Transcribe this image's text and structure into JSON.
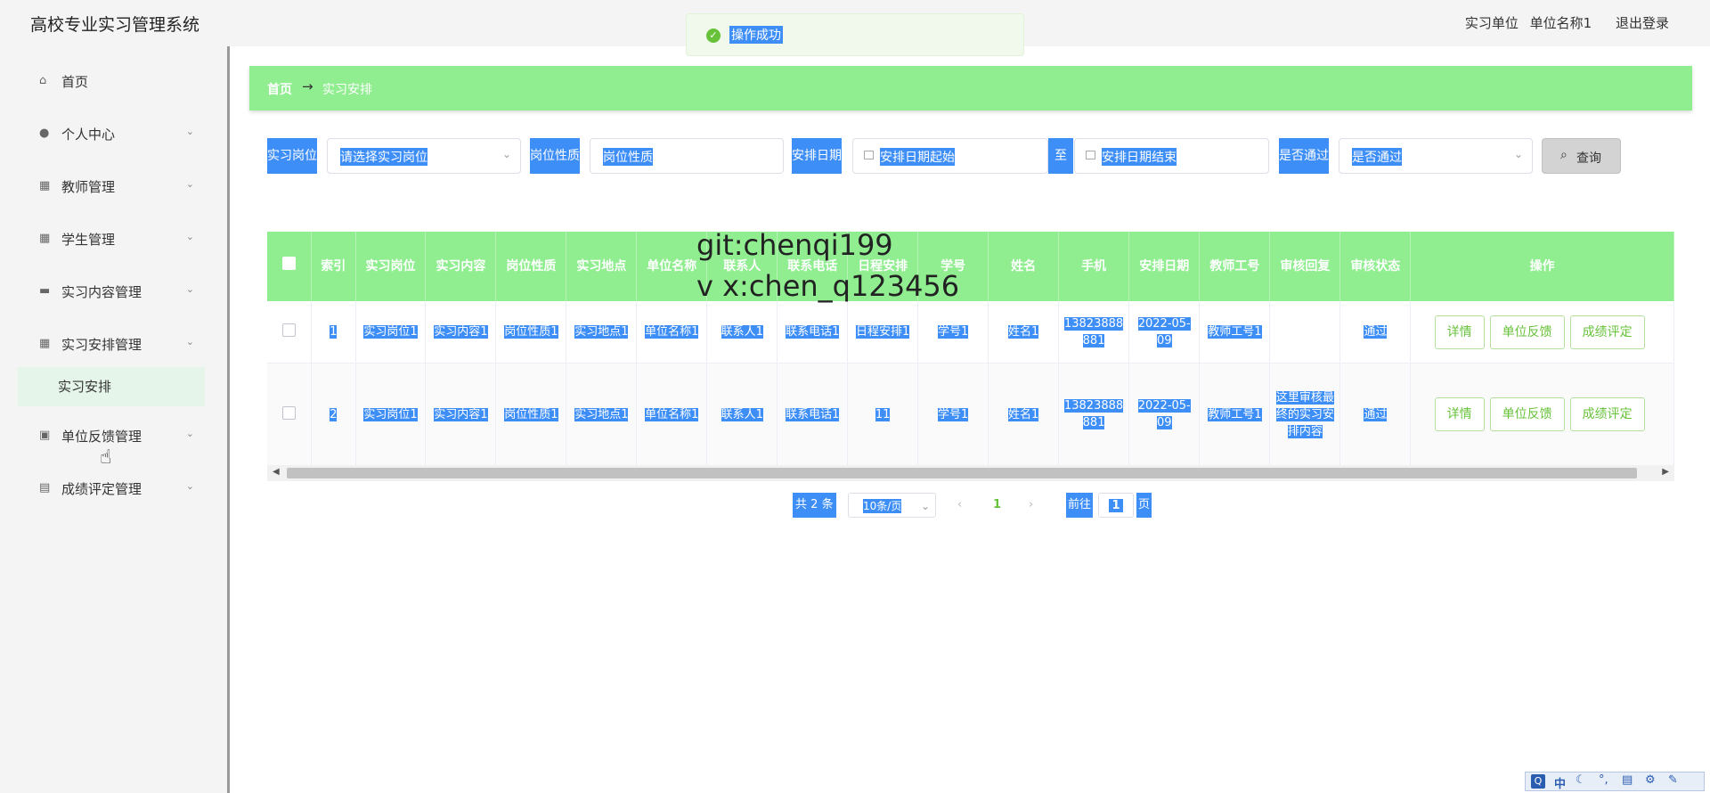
{
  "header": {
    "app_title": "高校专业实习管理系统",
    "role": "实习单位",
    "user_name": "单位名称1",
    "logout": "退出登录"
  },
  "toast": {
    "message": "操作成功"
  },
  "sidebar": {
    "items": [
      {
        "label": "首页",
        "icon": "home-icon"
      },
      {
        "label": "个人中心",
        "icon": "user-icon"
      },
      {
        "label": "教师管理",
        "icon": "grid-icon"
      },
      {
        "label": "学生管理",
        "icon": "grid-icon"
      },
      {
        "label": "实习内容管理",
        "icon": "ticket-icon"
      },
      {
        "label": "实习安排管理",
        "icon": "grid-icon"
      },
      {
        "label": "单位反馈管理",
        "icon": "briefcase-icon"
      },
      {
        "label": "成绩评定管理",
        "icon": "printer-icon"
      }
    ],
    "active_sub": "实习安排"
  },
  "breadcrumb": {
    "home": "首页",
    "separator": "→",
    "current": "实习安排"
  },
  "filters": {
    "position_label": "实习岗位",
    "position_placeholder": "请选择实习岗位",
    "nature_label": "岗位性质",
    "nature_placeholder": "岗位性质",
    "date_label": "安排日期",
    "date_start": "安排日期起始",
    "date_to": "至",
    "date_end": "安排日期结束",
    "pass_label": "是否通过",
    "pass_placeholder": "是否通过",
    "query": "查询"
  },
  "table": {
    "headers": [
      "索引",
      "实习岗位",
      "实习内容",
      "岗位性质",
      "实习地点",
      "单位名称",
      "联系人",
      "联系电话",
      "日程安排",
      "学号",
      "姓名",
      "手机",
      "安排日期",
      "教师工号",
      "审核回复",
      "审核状态",
      "操作"
    ],
    "rows": [
      [
        "1",
        "实习岗位1",
        "实习内容1",
        "岗位性质1",
        "实习地点1",
        "单位名称1",
        "联系人1",
        "联系电话1",
        "日程安排1",
        "学号1",
        "姓名1",
        "13823888881",
        "2022-05-09",
        "教师工号1",
        "",
        "通过"
      ],
      [
        "2",
        "实习岗位1",
        "实习内容1",
        "岗位性质1",
        "实习地点1",
        "单位名称1",
        "联系人1",
        "联系电话1",
        "11",
        "学号1",
        "姓名1",
        "13823888881",
        "2022-05-09",
        "教师工号1",
        "这里审核最终的实习安排内容",
        "通过"
      ]
    ],
    "actions": [
      "详情",
      "单位反馈",
      "成绩评定"
    ]
  },
  "pagination": {
    "total_prefix": "共",
    "total": "2",
    "total_suffix": "条",
    "page_size": "10条/页",
    "current_page": "1",
    "goto_prefix": "前往",
    "goto_value": "1",
    "goto_suffix": "页"
  },
  "watermark": {
    "line1": "git:chenqi199",
    "line2": "v x:chen_q123456"
  },
  "ime": {
    "text": "中"
  },
  "colors": {
    "accent": "#90ee90",
    "selection": "#3e8ef7",
    "success": "#67c23a"
  }
}
